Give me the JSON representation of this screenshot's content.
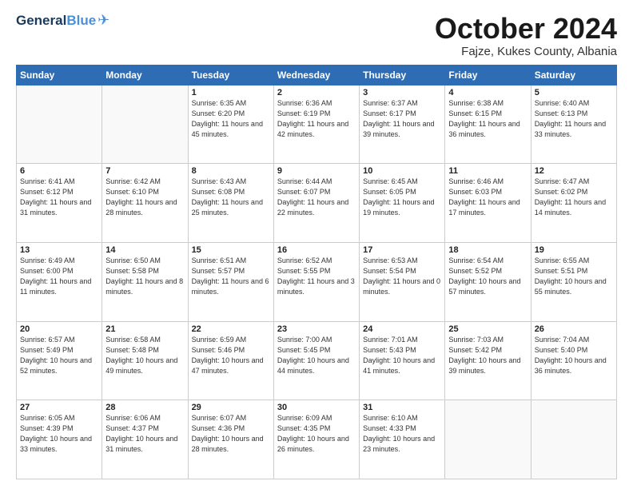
{
  "header": {
    "logo_general": "General",
    "logo_blue": "Blue",
    "month": "October 2024",
    "location": "Fajze, Kukes County, Albania"
  },
  "weekdays": [
    "Sunday",
    "Monday",
    "Tuesday",
    "Wednesday",
    "Thursday",
    "Friday",
    "Saturday"
  ],
  "weeks": [
    [
      {
        "day": "",
        "sunrise": "",
        "sunset": "",
        "daylight": ""
      },
      {
        "day": "",
        "sunrise": "",
        "sunset": "",
        "daylight": ""
      },
      {
        "day": "1",
        "sunrise": "Sunrise: 6:35 AM",
        "sunset": "Sunset: 6:20 PM",
        "daylight": "Daylight: 11 hours and 45 minutes."
      },
      {
        "day": "2",
        "sunrise": "Sunrise: 6:36 AM",
        "sunset": "Sunset: 6:19 PM",
        "daylight": "Daylight: 11 hours and 42 minutes."
      },
      {
        "day": "3",
        "sunrise": "Sunrise: 6:37 AM",
        "sunset": "Sunset: 6:17 PM",
        "daylight": "Daylight: 11 hours and 39 minutes."
      },
      {
        "day": "4",
        "sunrise": "Sunrise: 6:38 AM",
        "sunset": "Sunset: 6:15 PM",
        "daylight": "Daylight: 11 hours and 36 minutes."
      },
      {
        "day": "5",
        "sunrise": "Sunrise: 6:40 AM",
        "sunset": "Sunset: 6:13 PM",
        "daylight": "Daylight: 11 hours and 33 minutes."
      }
    ],
    [
      {
        "day": "6",
        "sunrise": "Sunrise: 6:41 AM",
        "sunset": "Sunset: 6:12 PM",
        "daylight": "Daylight: 11 hours and 31 minutes."
      },
      {
        "day": "7",
        "sunrise": "Sunrise: 6:42 AM",
        "sunset": "Sunset: 6:10 PM",
        "daylight": "Daylight: 11 hours and 28 minutes."
      },
      {
        "day": "8",
        "sunrise": "Sunrise: 6:43 AM",
        "sunset": "Sunset: 6:08 PM",
        "daylight": "Daylight: 11 hours and 25 minutes."
      },
      {
        "day": "9",
        "sunrise": "Sunrise: 6:44 AM",
        "sunset": "Sunset: 6:07 PM",
        "daylight": "Daylight: 11 hours and 22 minutes."
      },
      {
        "day": "10",
        "sunrise": "Sunrise: 6:45 AM",
        "sunset": "Sunset: 6:05 PM",
        "daylight": "Daylight: 11 hours and 19 minutes."
      },
      {
        "day": "11",
        "sunrise": "Sunrise: 6:46 AM",
        "sunset": "Sunset: 6:03 PM",
        "daylight": "Daylight: 11 hours and 17 minutes."
      },
      {
        "day": "12",
        "sunrise": "Sunrise: 6:47 AM",
        "sunset": "Sunset: 6:02 PM",
        "daylight": "Daylight: 11 hours and 14 minutes."
      }
    ],
    [
      {
        "day": "13",
        "sunrise": "Sunrise: 6:49 AM",
        "sunset": "Sunset: 6:00 PM",
        "daylight": "Daylight: 11 hours and 11 minutes."
      },
      {
        "day": "14",
        "sunrise": "Sunrise: 6:50 AM",
        "sunset": "Sunset: 5:58 PM",
        "daylight": "Daylight: 11 hours and 8 minutes."
      },
      {
        "day": "15",
        "sunrise": "Sunrise: 6:51 AM",
        "sunset": "Sunset: 5:57 PM",
        "daylight": "Daylight: 11 hours and 6 minutes."
      },
      {
        "day": "16",
        "sunrise": "Sunrise: 6:52 AM",
        "sunset": "Sunset: 5:55 PM",
        "daylight": "Daylight: 11 hours and 3 minutes."
      },
      {
        "day": "17",
        "sunrise": "Sunrise: 6:53 AM",
        "sunset": "Sunset: 5:54 PM",
        "daylight": "Daylight: 11 hours and 0 minutes."
      },
      {
        "day": "18",
        "sunrise": "Sunrise: 6:54 AM",
        "sunset": "Sunset: 5:52 PM",
        "daylight": "Daylight: 10 hours and 57 minutes."
      },
      {
        "day": "19",
        "sunrise": "Sunrise: 6:55 AM",
        "sunset": "Sunset: 5:51 PM",
        "daylight": "Daylight: 10 hours and 55 minutes."
      }
    ],
    [
      {
        "day": "20",
        "sunrise": "Sunrise: 6:57 AM",
        "sunset": "Sunset: 5:49 PM",
        "daylight": "Daylight: 10 hours and 52 minutes."
      },
      {
        "day": "21",
        "sunrise": "Sunrise: 6:58 AM",
        "sunset": "Sunset: 5:48 PM",
        "daylight": "Daylight: 10 hours and 49 minutes."
      },
      {
        "day": "22",
        "sunrise": "Sunrise: 6:59 AM",
        "sunset": "Sunset: 5:46 PM",
        "daylight": "Daylight: 10 hours and 47 minutes."
      },
      {
        "day": "23",
        "sunrise": "Sunrise: 7:00 AM",
        "sunset": "Sunset: 5:45 PM",
        "daylight": "Daylight: 10 hours and 44 minutes."
      },
      {
        "day": "24",
        "sunrise": "Sunrise: 7:01 AM",
        "sunset": "Sunset: 5:43 PM",
        "daylight": "Daylight: 10 hours and 41 minutes."
      },
      {
        "day": "25",
        "sunrise": "Sunrise: 7:03 AM",
        "sunset": "Sunset: 5:42 PM",
        "daylight": "Daylight: 10 hours and 39 minutes."
      },
      {
        "day": "26",
        "sunrise": "Sunrise: 7:04 AM",
        "sunset": "Sunset: 5:40 PM",
        "daylight": "Daylight: 10 hours and 36 minutes."
      }
    ],
    [
      {
        "day": "27",
        "sunrise": "Sunrise: 6:05 AM",
        "sunset": "Sunset: 4:39 PM",
        "daylight": "Daylight: 10 hours and 33 minutes."
      },
      {
        "day": "28",
        "sunrise": "Sunrise: 6:06 AM",
        "sunset": "Sunset: 4:37 PM",
        "daylight": "Daylight: 10 hours and 31 minutes."
      },
      {
        "day": "29",
        "sunrise": "Sunrise: 6:07 AM",
        "sunset": "Sunset: 4:36 PM",
        "daylight": "Daylight: 10 hours and 28 minutes."
      },
      {
        "day": "30",
        "sunrise": "Sunrise: 6:09 AM",
        "sunset": "Sunset: 4:35 PM",
        "daylight": "Daylight: 10 hours and 26 minutes."
      },
      {
        "day": "31",
        "sunrise": "Sunrise: 6:10 AM",
        "sunset": "Sunset: 4:33 PM",
        "daylight": "Daylight: 10 hours and 23 minutes."
      },
      {
        "day": "",
        "sunrise": "",
        "sunset": "",
        "daylight": ""
      },
      {
        "day": "",
        "sunrise": "",
        "sunset": "",
        "daylight": ""
      }
    ]
  ]
}
